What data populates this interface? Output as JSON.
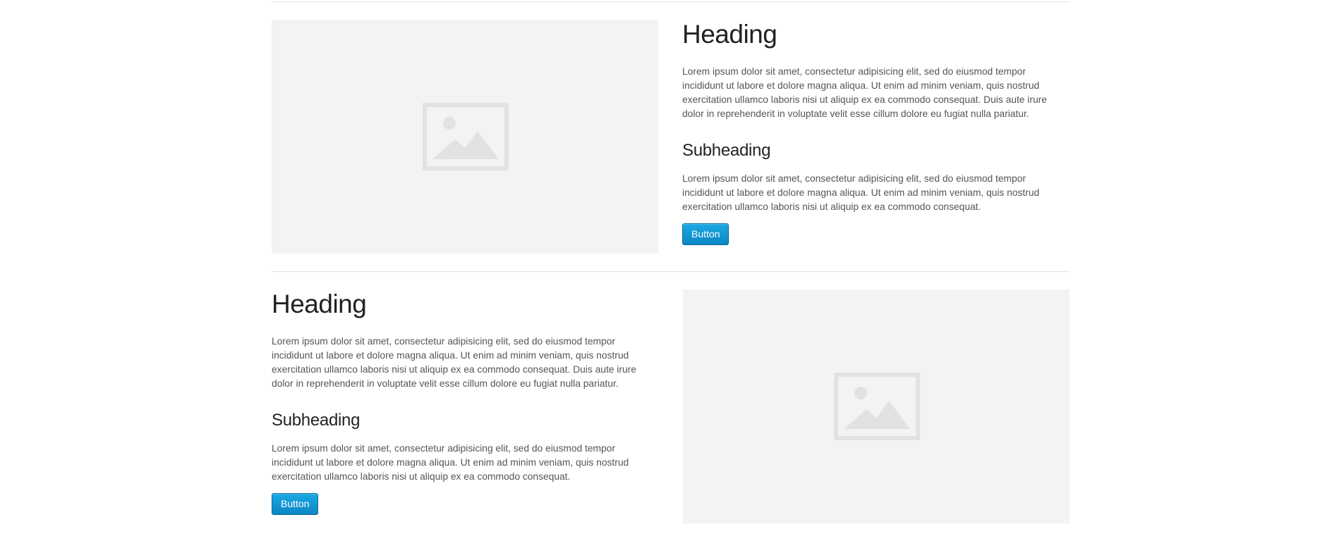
{
  "sections": [
    {
      "heading": "Heading",
      "body": "Lorem ipsum dolor sit amet, consectetur adipisicing elit, sed do eiusmod tempor incididunt ut labore et dolore magna aliqua. Ut enim ad minim veniam, quis nostrud exercitation ullamco laboris nisi ut aliquip ex ea commodo consequat. Duis aute irure dolor in reprehenderit in voluptate velit esse cillum dolore eu fugiat nulla pariatur.",
      "subheading": "Subheading",
      "subbody": "Lorem ipsum dolor sit amet, consectetur adipisicing elit, sed do eiusmod tempor incididunt ut labore et dolore magna aliqua. Ut enim ad minim veniam, quis nostrud exercitation ullamco laboris nisi ut aliquip ex ea commodo consequat.",
      "button_label": "Button",
      "image_icon": "image-placeholder-icon"
    },
    {
      "heading": "Heading",
      "body": "Lorem ipsum dolor sit amet, consectetur adipisicing elit, sed do eiusmod tempor incididunt ut labore et dolore magna aliqua. Ut enim ad minim veniam, quis nostrud exercitation ullamco laboris nisi ut aliquip ex ea commodo consequat. Duis aute irure dolor in reprehenderit in voluptate velit esse cillum dolore eu fugiat nulla pariatur.",
      "subheading": "Subheading",
      "subbody": "Lorem ipsum dolor sit amet, consectetur adipisicing elit, sed do eiusmod tempor incididunt ut labore et dolore magna aliqua. Ut enim ad minim veniam, quis nostrud exercitation ullamco laboris nisi ut aliquip ex ea commodo consequat.",
      "button_label": "Button",
      "image_icon": "image-placeholder-icon"
    }
  ],
  "colors": {
    "button": "#0b95d6",
    "placeholder_bg": "#f3f3f3",
    "placeholder_icon": "#e2e2e2",
    "heading": "#222222",
    "text": "#555555"
  }
}
